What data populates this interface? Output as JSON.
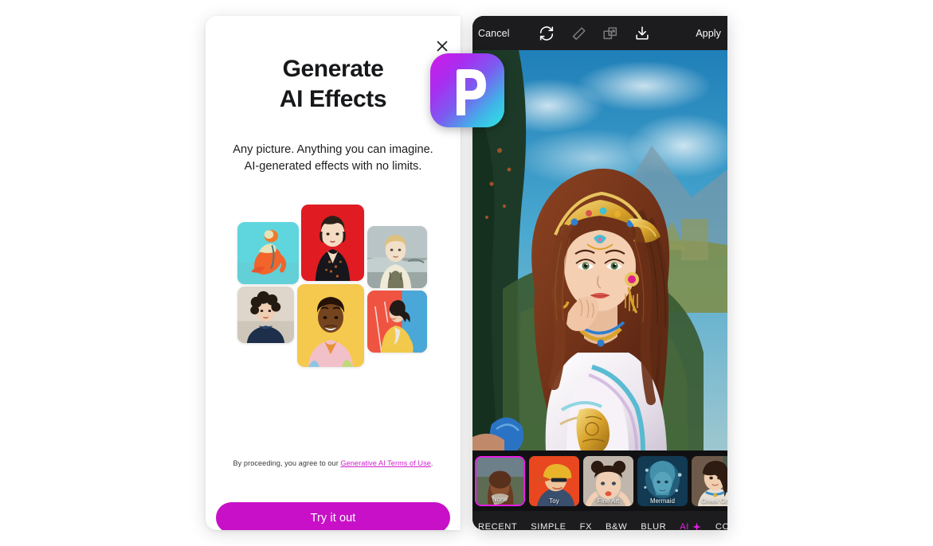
{
  "promo": {
    "close_icon": "close-icon",
    "title_line1": "Generate",
    "title_line2": "AI Effects",
    "subtitle": "Any picture. Anything you can imagine. AI-generated effects with no limits.",
    "terms_prefix": "By proceeding, you agree to our ",
    "terms_link": "Generative AI Terms of Use",
    "terms_suffix": ".",
    "cta_label": "Try it out",
    "collage": [
      {
        "name": "illustration-dancer-teal",
        "alt": "Teal background figure in orange outfit"
      },
      {
        "name": "illustration-woman-red",
        "alt": "Woman with bob haircut on red background"
      },
      {
        "name": "illustration-girl-overalls",
        "alt": "Blonde girl in overalls, muted seaside"
      },
      {
        "name": "illustration-curly-hair",
        "alt": "Person with curly hair and navy turtleneck"
      },
      {
        "name": "illustration-smiling-man",
        "alt": "Smiling man on yellow background"
      },
      {
        "name": "illustration-yellow-coat",
        "alt": "Person in yellow coat on red-blue background"
      }
    ]
  },
  "logo": {
    "name": "picsart-logo",
    "letter": "P",
    "gradient_from": "#d119e8",
    "gradient_to": "#2ee6e0"
  },
  "editor": {
    "topbar": {
      "cancel_label": "Cancel",
      "apply_label": "Apply",
      "icons": [
        {
          "name": "refresh-icon",
          "label": "Regenerate",
          "enabled": true
        },
        {
          "name": "eraser-icon",
          "label": "Eraser",
          "enabled": false
        },
        {
          "name": "compare-icon",
          "label": "Compare",
          "enabled": false
        },
        {
          "name": "download-icon",
          "label": "Download",
          "enabled": true
        }
      ]
    },
    "canvas": {
      "name": "edited-photo",
      "alt": "Illustrated woman with golden headdress and white robe against blue sky"
    },
    "effects": [
      {
        "label": "None",
        "selected": true
      },
      {
        "label": "Toy",
        "selected": false
      },
      {
        "label": "Fine Art",
        "selected": false
      },
      {
        "label": "Mermaid",
        "selected": false
      },
      {
        "label": "Greek God",
        "selected": false
      }
    ],
    "tabs": [
      {
        "label": "RECENT",
        "active": false,
        "icon": null
      },
      {
        "label": "SIMPLE",
        "active": false,
        "icon": null
      },
      {
        "label": "FX",
        "active": false,
        "icon": null
      },
      {
        "label": "B&W",
        "active": false,
        "icon": null
      },
      {
        "label": "BLUR",
        "active": false,
        "icon": null
      },
      {
        "label": "AI",
        "active": true,
        "icon": "sparkle-icon"
      },
      {
        "label": "COLOR",
        "active": false,
        "icon": null
      }
    ]
  },
  "colors": {
    "magenta": "#c810c8",
    "accent_pink": "#e61ee6",
    "link": "#cf1ecf",
    "panel_dark": "#111113",
    "bar_dark": "#1c1c1e"
  }
}
